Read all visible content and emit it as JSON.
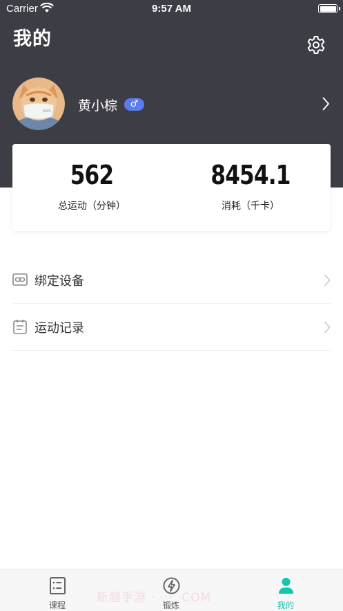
{
  "status_bar": {
    "carrier": "Carrier",
    "time": "9:57 AM"
  },
  "header": {
    "title": "我的"
  },
  "profile": {
    "name": "黄小棕",
    "gender_symbol": "♂"
  },
  "stats": {
    "total_exercise": {
      "value": "562",
      "label": "总运动（分钟）"
    },
    "calories": {
      "value": "8454.1",
      "label": "消耗（千卡）"
    }
  },
  "menu": [
    {
      "label": "绑定设备",
      "icon": "link-icon"
    },
    {
      "label": "运动记录",
      "icon": "calendar-icon"
    }
  ],
  "tabs": [
    {
      "label": "课程",
      "icon": "course-list-icon",
      "active": false
    },
    {
      "label": "锻炼",
      "icon": "lightning-icon",
      "active": false
    },
    {
      "label": "我的",
      "icon": "person-icon",
      "active": true
    }
  ],
  "watermark": "新趣手游 · ··· ·COM",
  "colors": {
    "header_bg": "#3d3d45",
    "accent": "#10c7b0",
    "gender_badge": "#5b7cf0"
  }
}
